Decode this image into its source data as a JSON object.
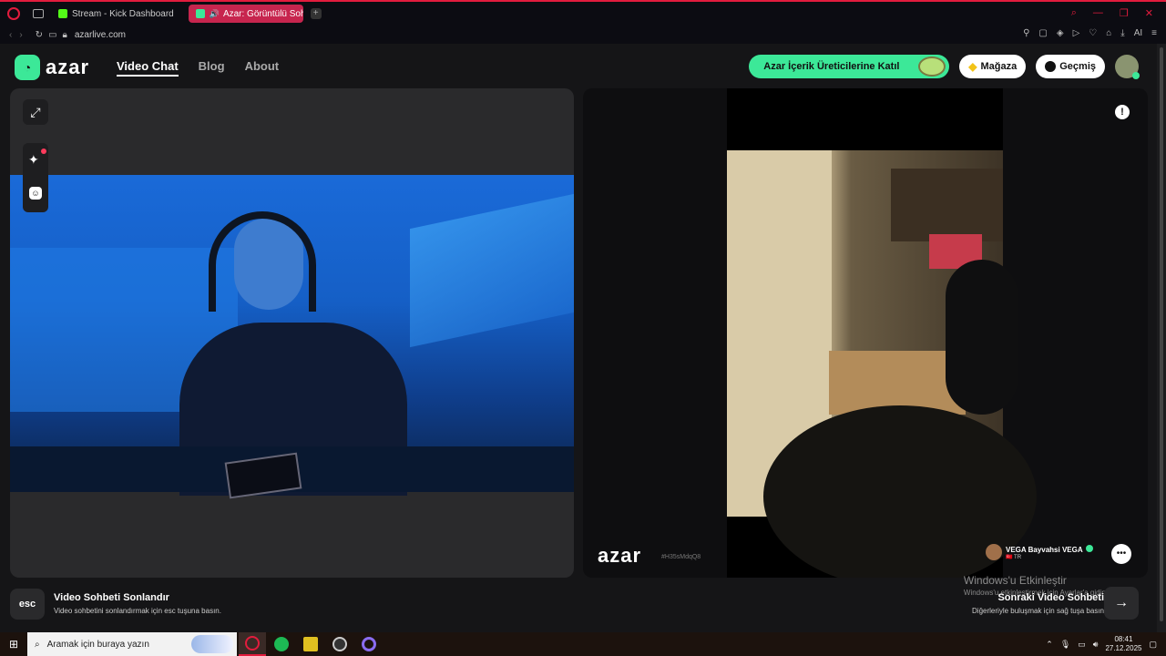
{
  "browser": {
    "tabs": [
      {
        "label": "Stream - Kick Dashboard",
        "active": false
      },
      {
        "label": "Azar: Görüntülü Sohbe",
        "active": true
      }
    ],
    "url": "azarlive.com",
    "window_controls": [
      "search-icon",
      "minimize-icon",
      "maximize-icon",
      "close-icon"
    ]
  },
  "header": {
    "brand": "azar",
    "nav": [
      "Video Chat",
      "Blog",
      "About"
    ],
    "creator_button": "Azar İçerik Üreticilerine Katıl",
    "shop_button": "Mağaza",
    "history_button": "Geçmiş"
  },
  "remote": {
    "watermark": "azar",
    "watermark_id": "#H35sMdqQ8",
    "peer_name": "VEGA Bayvahsi VEGA",
    "peer_country": "TR"
  },
  "footer": {
    "esc_key": "esc",
    "end_title": "Video Sohbeti Sonlandır",
    "end_sub": "Video sohbetini sonlandırmak için esc tuşuna basın.",
    "next_title": "Sonraki Video Sohbeti",
    "next_sub": "Diğerleriyle buluşmak için sağ tuşa basın",
    "activate_title": "Windows'u Etkinleştir",
    "activate_sub": "Windows'u etkinleştirmek için Ayarlar'a gidin."
  },
  "taskbar": {
    "search_placeholder": "Aramak için buraya yazın",
    "time": "08:41",
    "date": "27.12.2025"
  },
  "colors": {
    "accent": "#3ce898",
    "opera": "#e21c3d",
    "tab_active": "#c7254e"
  }
}
